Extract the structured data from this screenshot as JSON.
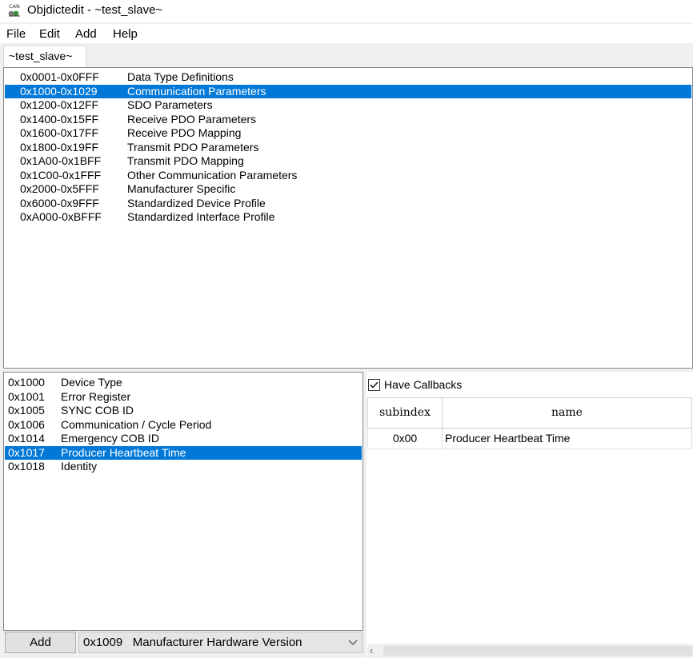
{
  "window": {
    "title": "Objdictedit - ~test_slave~",
    "icon": "can-app-icon",
    "icon_text": "CAN"
  },
  "menu": [
    "File",
    "Edit",
    "Add",
    "Help"
  ],
  "tab": {
    "label": "~test_slave~"
  },
  "ranges": [
    {
      "range": "0x0001-0x0FFF",
      "name": "Data Type Definitions"
    },
    {
      "range": "0x1000-0x1029",
      "name": "Communication Parameters",
      "selected": true
    },
    {
      "range": "0x1200-0x12FF",
      "name": "SDO Parameters"
    },
    {
      "range": "0x1400-0x15FF",
      "name": "Receive PDO Parameters"
    },
    {
      "range": "0x1600-0x17FF",
      "name": "Receive PDO Mapping"
    },
    {
      "range": "0x1800-0x19FF",
      "name": "Transmit PDO Parameters"
    },
    {
      "range": "0x1A00-0x1BFF",
      "name": "Transmit PDO Mapping"
    },
    {
      "range": "0x1C00-0x1FFF",
      "name": "Other Communication Parameters"
    },
    {
      "range": "0x2000-0x5FFF",
      "name": "Manufacturer Specific"
    },
    {
      "range": "0x6000-0x9FFF",
      "name": "Standardized Device Profile"
    },
    {
      "range": "0xA000-0xBFFF",
      "name": "Standardized Interface Profile"
    }
  ],
  "indexes": [
    {
      "index": "0x1000",
      "name": "Device Type"
    },
    {
      "index": "0x1001",
      "name": "Error Register"
    },
    {
      "index": "0x1005",
      "name": "SYNC COB ID"
    },
    {
      "index": "0x1006",
      "name": "Communication / Cycle Period"
    },
    {
      "index": "0x1014",
      "name": "Emergency COB ID"
    },
    {
      "index": "0x1017",
      "name": "Producer Heartbeat Time",
      "selected": true
    },
    {
      "index": "0x1018",
      "name": "Identity"
    }
  ],
  "callbacks": {
    "label": "Have Callbacks",
    "checked": true
  },
  "grid": {
    "columns": [
      "subindex",
      "name"
    ],
    "rows": [
      {
        "subindex": "0x00",
        "name": "Producer Heartbeat Time"
      }
    ]
  },
  "add_button": {
    "label": "Add"
  },
  "add_combo": {
    "index": "0x1009",
    "name": "Manufacturer Hardware Version"
  },
  "colors": {
    "selection": "#0078d7",
    "window_bg": "#f0f0f0"
  }
}
